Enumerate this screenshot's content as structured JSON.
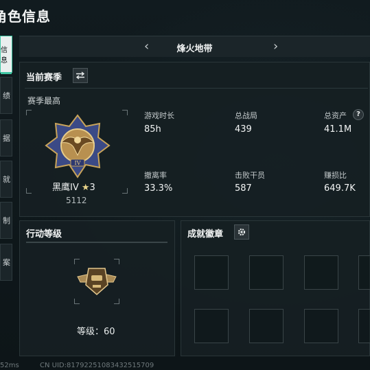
{
  "page": {
    "title": "角色信息"
  },
  "nav": {
    "items": [
      {
        "label": "信息",
        "active": true
      },
      {
        "label": "绩",
        "active": false
      },
      {
        "label": "据",
        "active": false
      },
      {
        "label": "就",
        "active": false
      },
      {
        "label": "制",
        "active": false
      },
      {
        "label": "案",
        "active": false
      }
    ]
  },
  "map_selector": {
    "name": "烽火地带",
    "prev_icon": "chevron-left-icon",
    "next_icon": "chevron-right-icon"
  },
  "season": {
    "title": "当前赛季",
    "switch_icon": "swap-arrows-icon",
    "best_label": "赛季最高",
    "rank_name": "黑鹰IV",
    "rank_stars": "3",
    "rank_score": "5112",
    "stats": [
      {
        "label": "游戏时长",
        "value": "85h"
      },
      {
        "label": "总战局",
        "value": "439"
      },
      {
        "label": "总资产",
        "value": "41.1M"
      },
      {
        "label": "撤离率",
        "value": "33.3%"
      },
      {
        "label": "击败干员",
        "value": "587"
      },
      {
        "label": "赚损比",
        "value": "649.7K"
      }
    ],
    "help_label": "?"
  },
  "action_level": {
    "title": "行动等级",
    "level_label": "等级：",
    "level_value": "60"
  },
  "achievements": {
    "title": "成就徽章",
    "settings_icon": "gear-icon"
  },
  "footer": {
    "ping": "52ms",
    "uid": "CN UID:8179225108343251570​9"
  },
  "colors": {
    "accent": "#3fc6a4",
    "panel": "#161f23",
    "background": "#0e1619"
  }
}
